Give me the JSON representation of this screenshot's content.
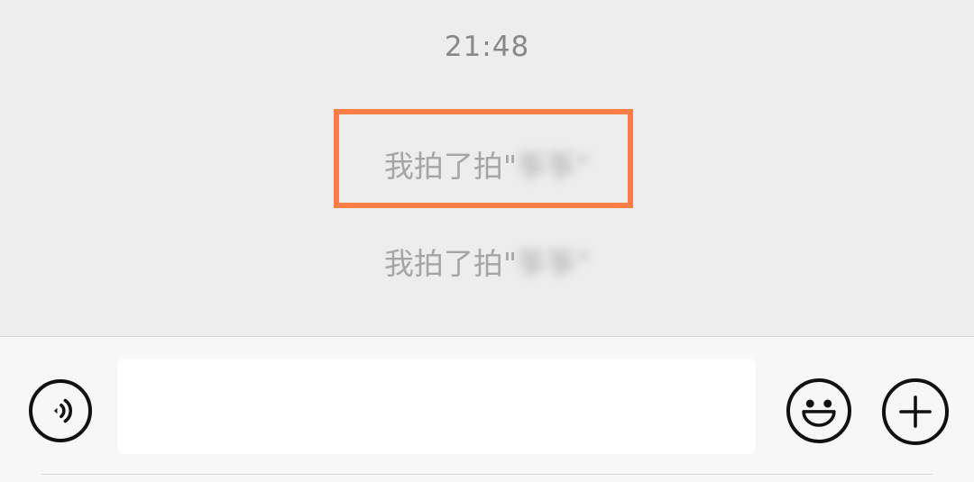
{
  "chat": {
    "timestamp": "21:48",
    "messages": [
      {
        "prefix": "我拍了拍\"",
        "name": "筝筝\""
      },
      {
        "prefix": "我拍了拍\"",
        "name": "筝筝\""
      }
    ]
  },
  "input_bar": {
    "message_value": "",
    "icons": [
      "voice-icon",
      "emoji-icon",
      "plus-icon"
    ]
  },
  "colors": {
    "highlight": "#fb7c44",
    "background": "#ededed",
    "input_bar": "#f7f7f7"
  }
}
